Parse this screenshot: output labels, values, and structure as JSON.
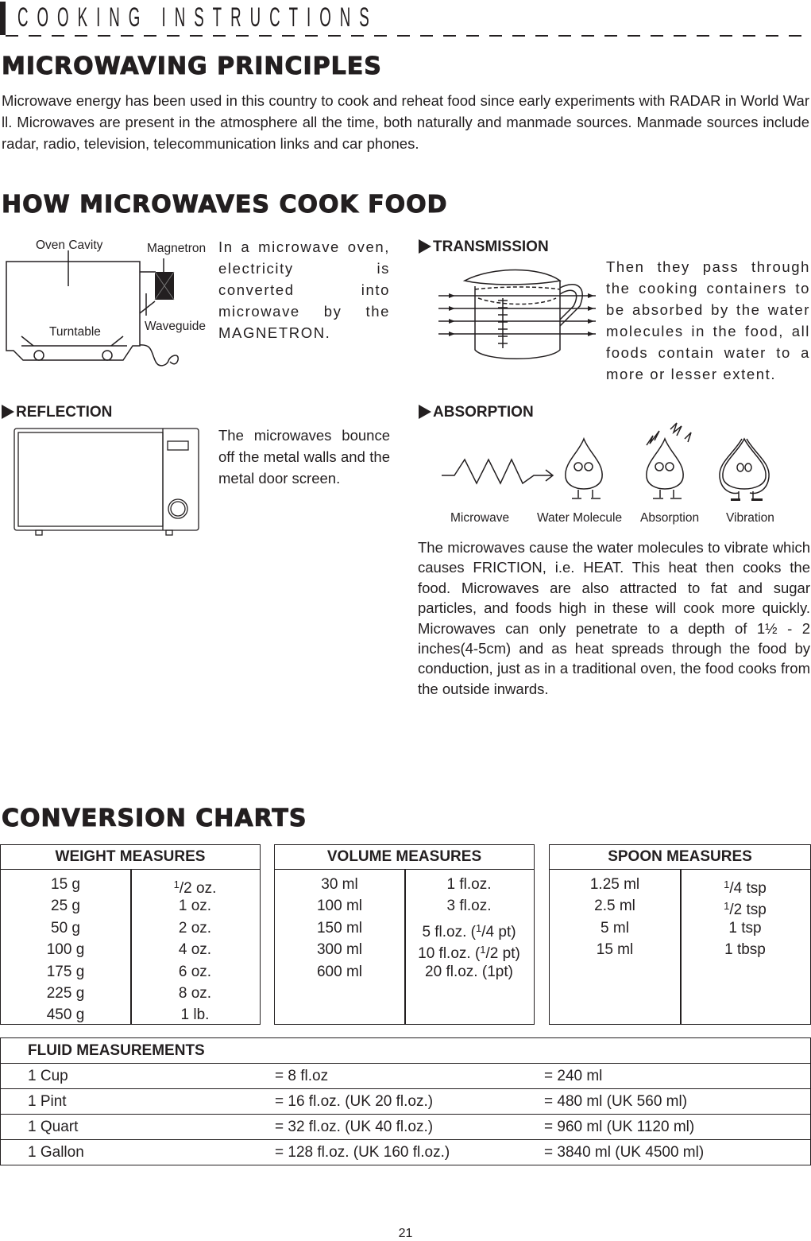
{
  "header": {
    "title": "COOKING INSTRUCTIONS"
  },
  "principles": {
    "heading": "MICROWAVING PRINCIPLES",
    "body": "Microwave energy has been used in this country to cook and reheat food since early experiments with RADAR in World War ll. Microwaves are present in the atmosphere all the time, both naturally and manmade sources. Manmade sources include radar, radio, television, telecommunication links and car phones."
  },
  "how": {
    "heading": "HOW MICROWAVES COOK FOOD",
    "oven_diagram": {
      "labels": {
        "oven_cavity": "Oven Cavity",
        "magnetron": "Magnetron",
        "waveguide": "Waveguide",
        "turntable": "Turntable"
      },
      "text": "In a microwave oven, electricity is converted into microwave by the MAGNETRON."
    },
    "transmission": {
      "title": "TRANSMISSION",
      "text": "Then they pass through the cooking containers to be absorbed by the water molecules in the food, all foods contain water to a more or lesser extent."
    },
    "reflection": {
      "title": "REFLECTION",
      "text": "The microwaves bounce off the metal walls and the metal door screen."
    },
    "absorption": {
      "title": "ABSORPTION",
      "labels": [
        "Microwave",
        "Water Molecule",
        "Absorption",
        "Vibration"
      ],
      "text": "The microwaves cause the water molecules to vibrate which causes FRICTION, i.e. HEAT. This heat then cooks the food. Microwaves are also attracted to fat and sugar particles, and foods high in these will cook more quickly. Microwaves can only penetrate to a depth of 1½ - 2 inches(4-5cm) and as heat spreads through the food by conduction, just as in a traditional oven, the food cooks from the outside inwards."
    }
  },
  "conversion": {
    "heading": "CONVERSION CHARTS",
    "weight": {
      "title": "WEIGHT MEASURES",
      "metric": [
        "15 g",
        "25 g",
        "50 g",
        "100 g",
        "175 g",
        "225 g",
        "450 g"
      ],
      "imperial": [
        {
          "num": "1",
          "rest": "/2 oz."
        },
        {
          "num": "",
          "rest": "1 oz."
        },
        {
          "num": "",
          "rest": "2 oz."
        },
        {
          "num": "",
          "rest": "4 oz."
        },
        {
          "num": "",
          "rest": "6 oz."
        },
        {
          "num": "",
          "rest": "8 oz."
        },
        {
          "num": "",
          "rest": "1 lb."
        }
      ]
    },
    "volume": {
      "title": "VOLUME MEASURES",
      "metric": [
        "30 ml",
        "100 ml",
        "150 ml",
        "300 ml",
        "600 ml"
      ],
      "imperial": [
        {
          "pre": "1 fl.oz.",
          "num": "",
          "rest": ""
        },
        {
          "pre": "3 fl.oz.",
          "num": "",
          "rest": ""
        },
        {
          "pre": "5 fl.oz. (",
          "num": "1",
          "rest": "/4  pt)"
        },
        {
          "pre": "10 fl.oz. (",
          "num": "1",
          "rest": "/2  pt)"
        },
        {
          "pre": "20 fl.oz. (1pt)",
          "num": "",
          "rest": ""
        }
      ]
    },
    "spoon": {
      "title": "SPOON MEASURES",
      "metric": [
        "1.25 ml",
        "2.5 ml",
        "5 ml",
        "15 ml"
      ],
      "imperial": [
        {
          "num": "1",
          "rest": "/4 tsp"
        },
        {
          "num": "1",
          "rest": "/2 tsp"
        },
        {
          "num": "",
          "rest": "1 tsp"
        },
        {
          "num": "",
          "rest": "1 tbsp"
        }
      ]
    },
    "fluid": {
      "title": "FLUID MEASUREMENTS",
      "rows": [
        [
          "1 Cup",
          "= 8 fl.oz",
          "= 240 ml"
        ],
        [
          "1 Pint",
          "= 16 fl.oz. (UK 20 fl.oz.)",
          "= 480 ml (UK 560 ml)"
        ],
        [
          "1 Quart",
          "= 32 fl.oz. (UK 40 fl.oz.)",
          "= 960 ml (UK 1120 ml)"
        ],
        [
          "1 Gallon",
          "= 128 fl.oz. (UK 160 fl.oz.)",
          "= 3840 ml (UK 4500 ml)"
        ]
      ]
    }
  },
  "footer": {
    "page_number": "21"
  }
}
